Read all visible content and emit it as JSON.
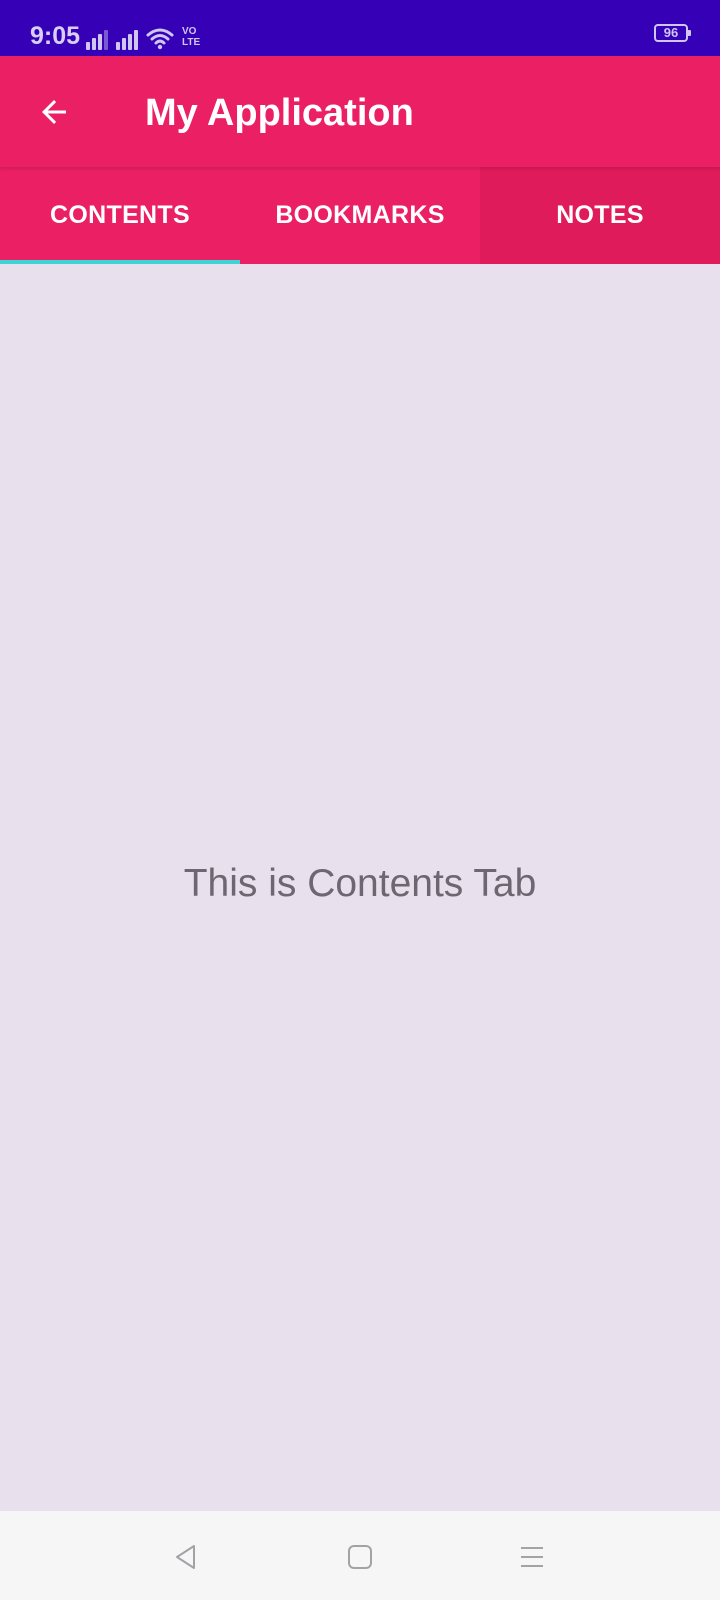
{
  "status_bar": {
    "time": "9:05",
    "volte": "VO\nLTE",
    "battery": "96",
    "icons": [
      "signal-icon",
      "signal-icon",
      "wifi-icon",
      "volte-icon",
      "battery-icon"
    ]
  },
  "app_bar": {
    "title": "My Application",
    "back_icon": "arrow-back-icon"
  },
  "tabs": [
    {
      "label": "CONTENTS",
      "selected": true
    },
    {
      "label": "BOOKMARKS",
      "selected": false
    },
    {
      "label": "NOTES",
      "selected": false
    }
  ],
  "main": {
    "text": "This is Contents Tab"
  },
  "nav_bar": {
    "icons": [
      "back-triangle-icon",
      "home-square-icon",
      "menu-lines-icon"
    ]
  },
  "colors": {
    "status_bar": "#3600b6",
    "app_bar": "#eb1f63",
    "tab_indicator": "#3fd3d6",
    "background": "#e9e0ed",
    "content_text": "#6e6671",
    "nav_bar": "#f6f6f7"
  }
}
